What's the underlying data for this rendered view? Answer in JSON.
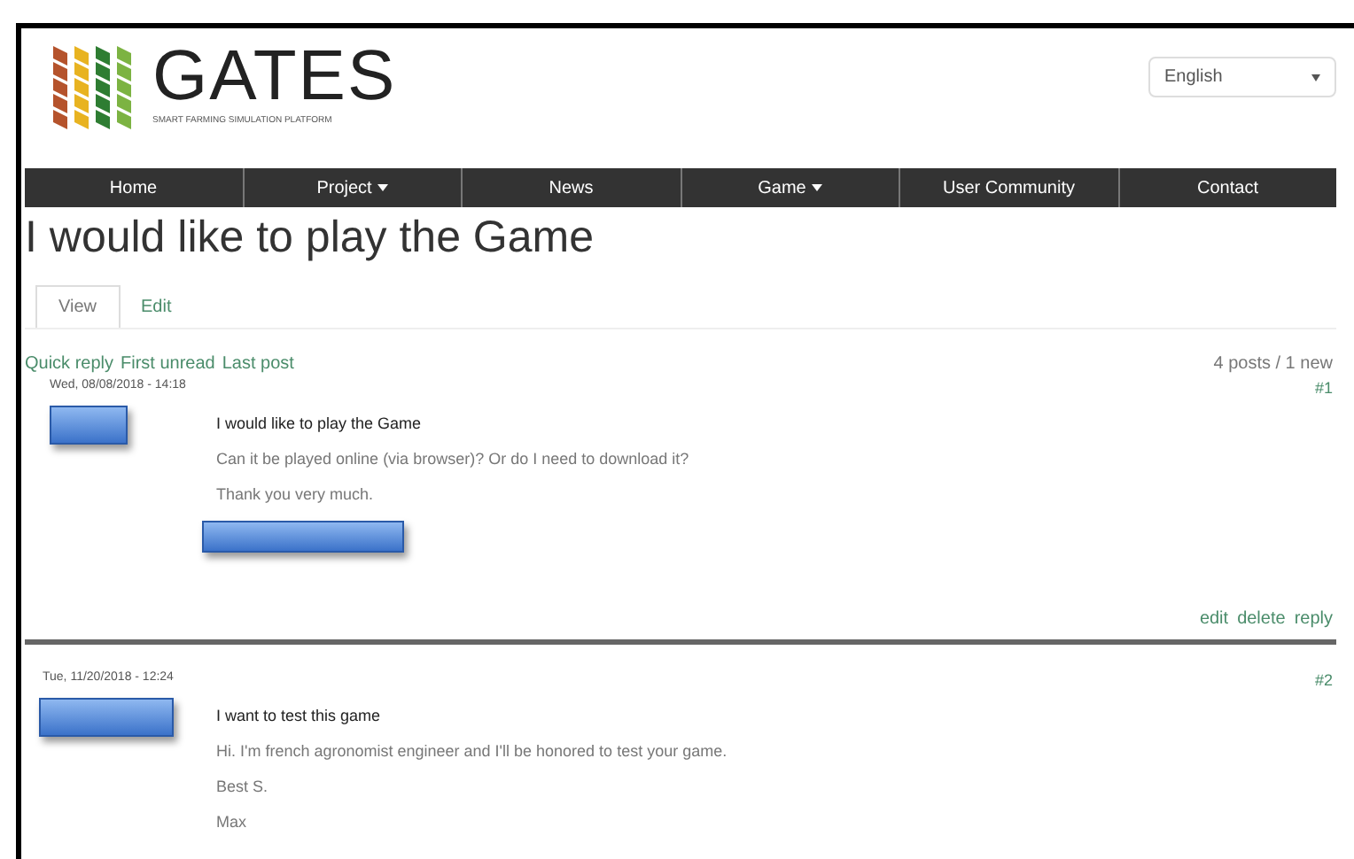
{
  "logo": {
    "name": "GATES",
    "tagline": "SMART FARMING SIMULATION PLATFORM"
  },
  "language": {
    "value": "English"
  },
  "nav": [
    {
      "label": "Home",
      "dropdown": false
    },
    {
      "label": "Project",
      "dropdown": true
    },
    {
      "label": "News",
      "dropdown": false
    },
    {
      "label": "Game",
      "dropdown": true
    },
    {
      "label": "User Community",
      "dropdown": false
    },
    {
      "label": "Contact",
      "dropdown": false
    }
  ],
  "page_title": "I would like to play the Game",
  "tabs": [
    {
      "label": "View",
      "selected": true
    },
    {
      "label": "Edit",
      "selected": false
    }
  ],
  "forum_links": [
    "Quick reply",
    "First unread",
    "Last post"
  ],
  "post_count": "4 posts / 1 new",
  "posts": [
    {
      "date": "Wed, 08/08/2018 - 14:18",
      "number": "#1",
      "title": "I would like to play the Game",
      "body": [
        "Can it be played online (via browser)? Or do I need to download it?",
        "Thank you very much."
      ],
      "signature_redacted": true,
      "actions": [
        "edit",
        "delete",
        "reply"
      ]
    },
    {
      "date": "Tue, 11/20/2018 - 12:24",
      "number": "#2",
      "title": "I want to test this game",
      "body": [
        "Hi. I'm french agronomist engineer and I'll be honored to test your game.",
        "Best S.",
        "Max"
      ],
      "signature_redacted": false
    }
  ]
}
